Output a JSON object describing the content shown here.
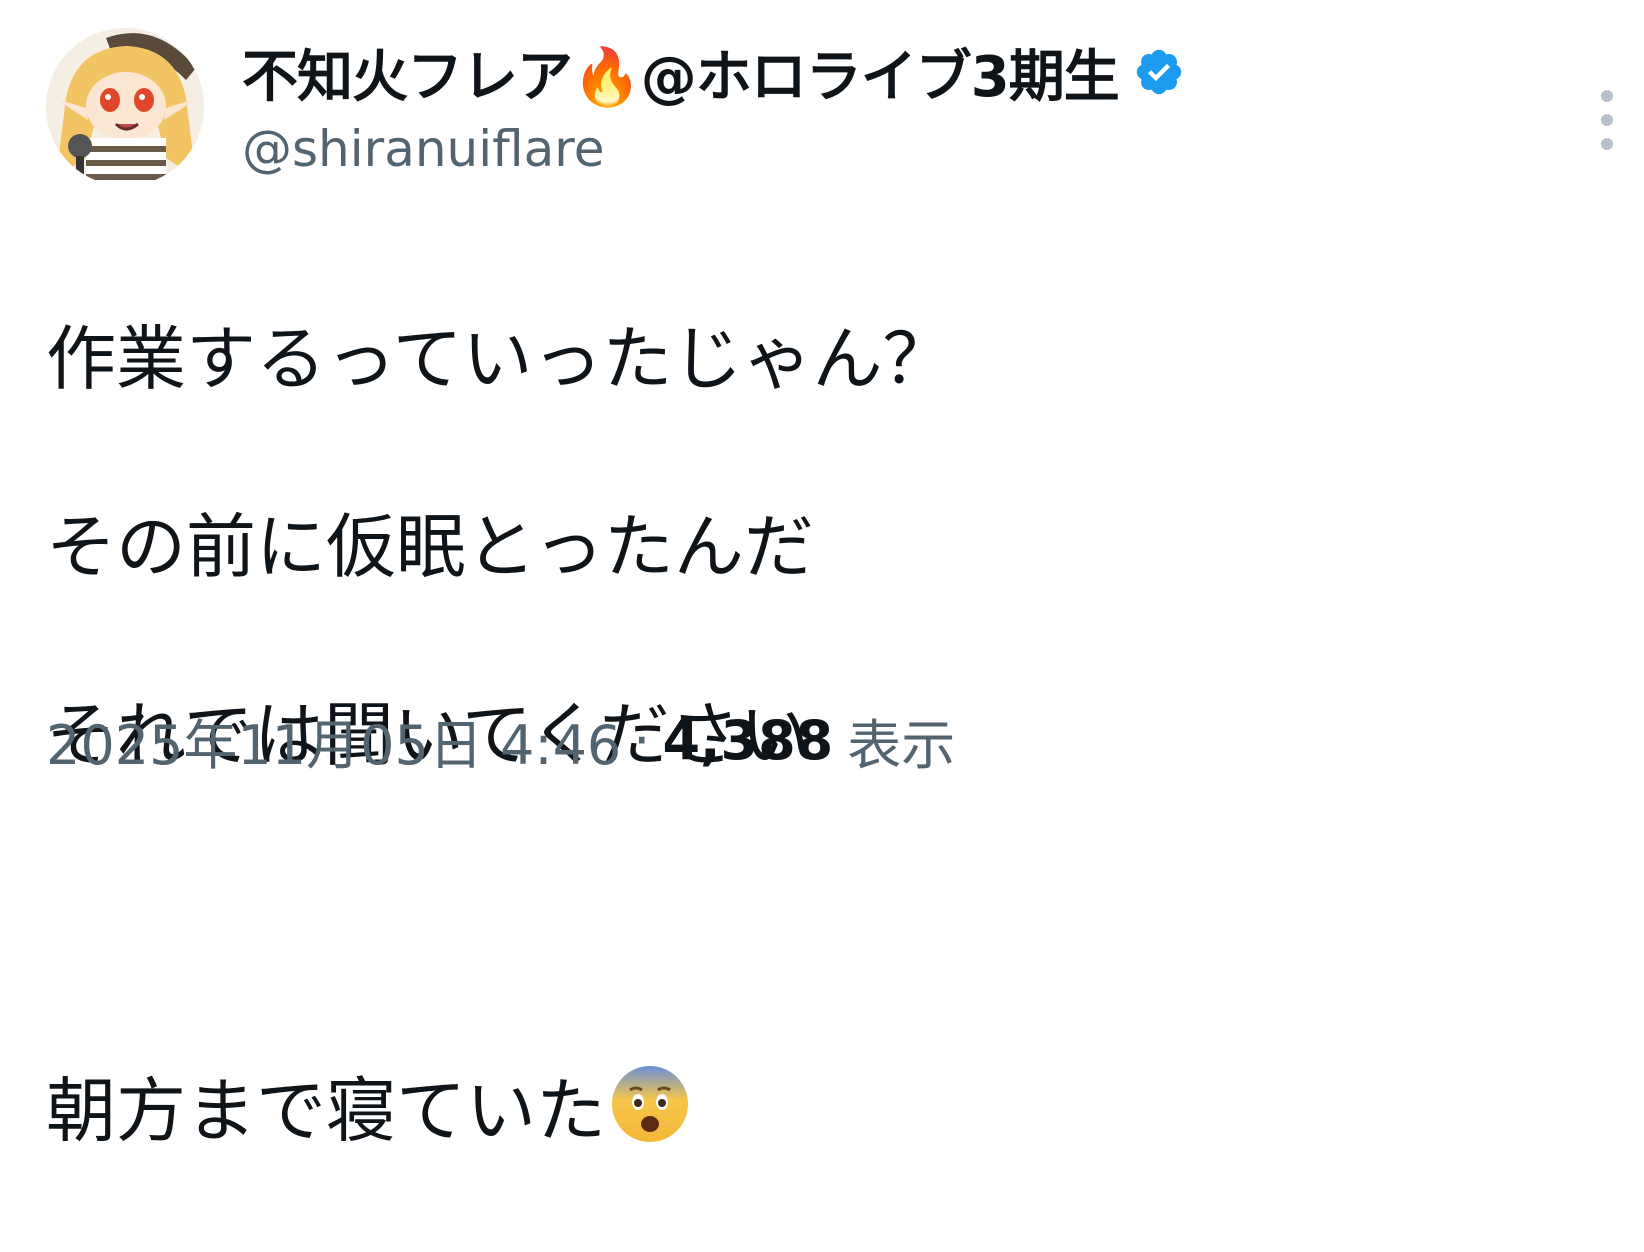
{
  "author": {
    "display_name": "不知火フレア🔥@ホロライブ3期生",
    "handle": "@shiranuiflare",
    "verified_color": "#1d9bf0",
    "avatar_icon": "avatar-image"
  },
  "tweet": {
    "lines": [
      "作業するっていったじゃん？",
      "その前に仮眠とったんだ",
      "それでは聞いてください",
      "",
      "朝方まで寝ていた"
    ],
    "trailing_emoji": "fearful-face-emoji"
  },
  "meta": {
    "timestamp": "2025年11月05日 4:46",
    "separator": "·",
    "views_count": "4,388",
    "views_label": "表示"
  },
  "more_icon": "more-vertical-icon"
}
